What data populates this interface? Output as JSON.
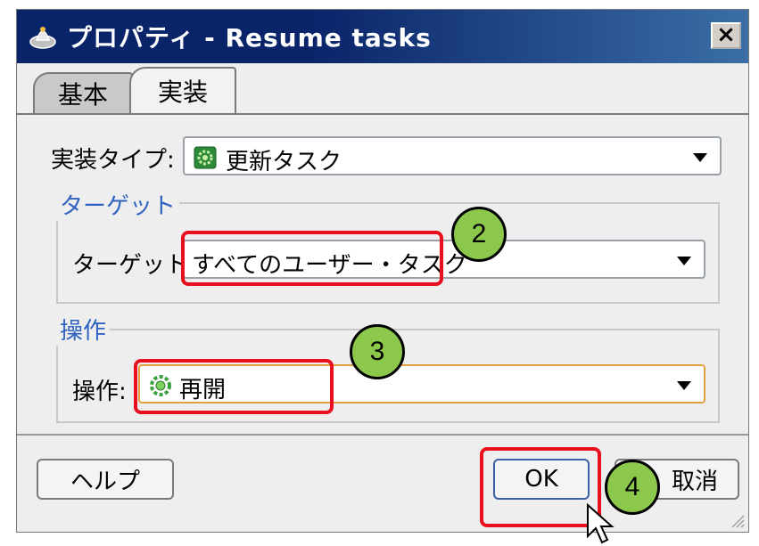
{
  "window": {
    "title": "プロパティ - Resume tasks",
    "close_label": "×",
    "title_icon": "properties-app-icon"
  },
  "tabs": [
    {
      "label": "基本",
      "active": false
    },
    {
      "label": "実装",
      "active": true
    }
  ],
  "impl_type": {
    "label": "実装タイプ:",
    "value": "更新タスク",
    "icon": "gear-icon"
  },
  "target_group": {
    "title": "ターゲット",
    "label": "ターゲット:",
    "value": "すべてのユーザー・タスク"
  },
  "operation_group": {
    "title": "操作",
    "label": "操作:",
    "value": "再開",
    "icon": "gear-icon"
  },
  "buttons": {
    "help": "ヘルプ",
    "ok": "OK",
    "cancel": "取消"
  },
  "callouts": [
    "2",
    "3",
    "4"
  ],
  "colors": {
    "title_bar": "#0a246a",
    "highlight": "#e8101c",
    "callout": "#8cc84b",
    "group_title": "#3063c0"
  }
}
